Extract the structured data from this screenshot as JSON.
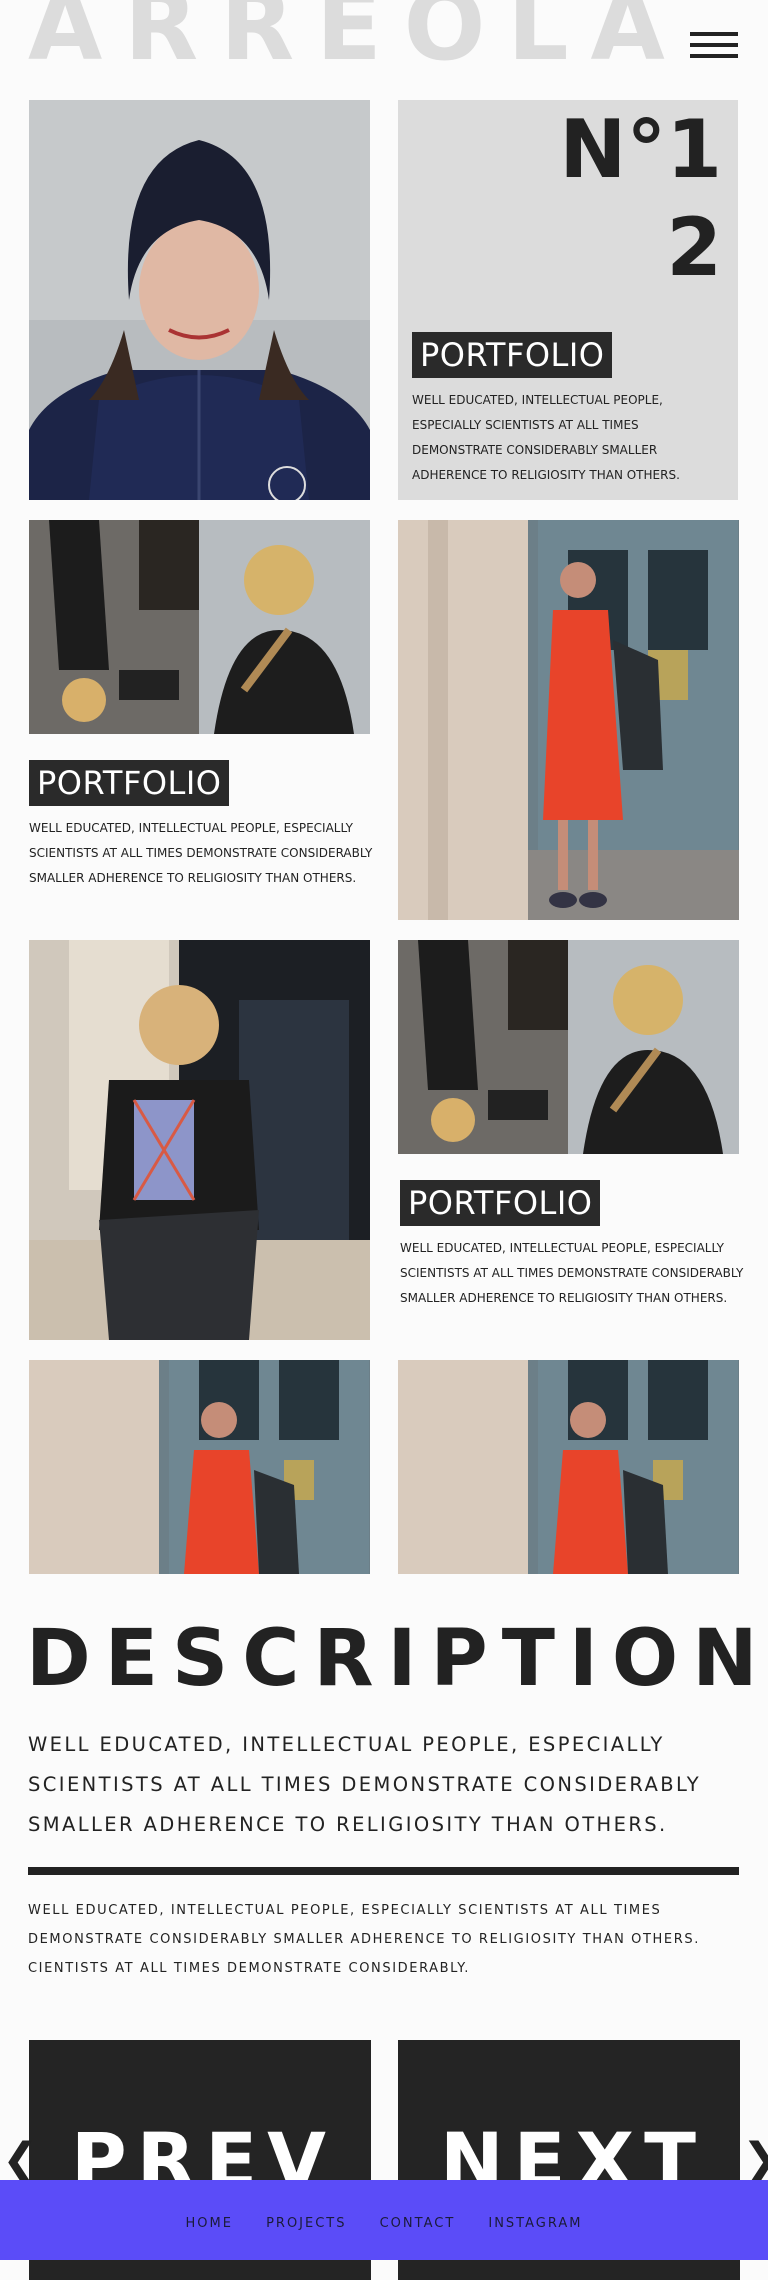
{
  "brand": {
    "name": "ARREOLA"
  },
  "hero": {
    "number_line1": "N°1",
    "number_line2": "2"
  },
  "cards": [
    {
      "tag": "PORTFOLIO",
      "text": "WELL EDUCATED, INTELLECTUAL PEOPLE, ESPECIALLY SCIENTISTS AT ALL TIMES DEMONSTRATE CONSIDERABLY SMALLER ADHERENCE TO RELIGIOSITY THAN OTHERS."
    },
    {
      "tag": "PORTFOLIO",
      "text": "WELL EDUCATED, INTELLECTUAL PEOPLE, ESPECIALLY SCIENTISTS AT ALL TIMES DEMONSTRATE CONSIDERABLY SMALLER ADHERENCE TO RELIGIOSITY THAN OTHERS."
    },
    {
      "tag": "PORTFOLIO",
      "text": "WELL EDUCATED, INTELLECTUAL PEOPLE, ESPECIALLY SCIENTISTS AT ALL TIMES DEMONSTRATE CONSIDERABLY SMALLER ADHERENCE TO RELIGIOSITY THAN OTHERS."
    }
  ],
  "description": {
    "heading": "DESCRIPTION",
    "subtitle": "WELL EDUCATED, INTELLECTUAL PEOPLE, ESPECIALLY SCIENTISTS AT ALL TIMES DEMONSTRATE CONSIDERABLY SMALLER ADHERENCE TO RELIGIOSITY THAN OTHERS.",
    "body": "WELL EDUCATED, INTELLECTUAL PEOPLE, ESPECIALLY SCIENTISTS AT ALL TIMES DEMONSTRATE CONSIDERABLY SMALLER ADHERENCE TO RELIGIOSITY THAN OTHERS. CIENTISTS AT ALL TIMES DEMONSTRATE CONSIDERABLY."
  },
  "pager": {
    "prev": "PREV",
    "next": "NEXT",
    "prev_arrow": "❮",
    "next_arrow": "❯"
  },
  "footer": {
    "links": [
      "HOME",
      "PROJECTS",
      "CONTACT",
      "INSTAGRAM"
    ]
  },
  "colors": {
    "footer_bg": "#5b4cf8",
    "tag_bg": "#2a2a2a",
    "accent_dress": "#e8442a"
  },
  "icons": {
    "menu": "hamburger-menu-icon",
    "prev": "chevron-left-icon",
    "next": "chevron-right-icon"
  }
}
